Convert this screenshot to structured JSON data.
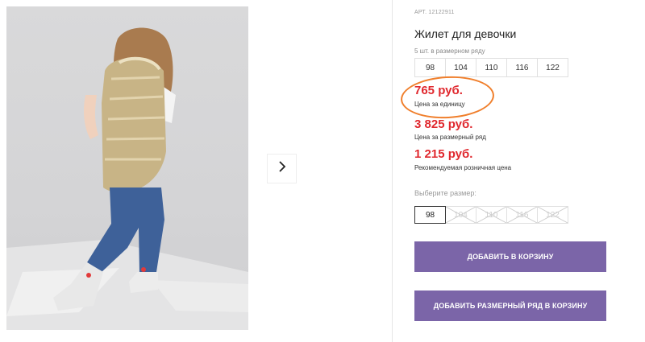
{
  "product": {
    "article": "АРТ. 12122911",
    "title": "Жилет для девочки",
    "pack_note": "5 шт. в размерном ряду",
    "sizes": [
      "98",
      "104",
      "110",
      "116",
      "122"
    ]
  },
  "prices": {
    "unit_price": "765 руб.",
    "unit_label": "Цена за единицу",
    "row_price": "3 825 руб.",
    "row_label": "Цена за размерный ряд",
    "retail_price": "1 215 руб.",
    "retail_label": "Рекомендуемая розничная цена"
  },
  "size_select": {
    "label": "Выберите размер:",
    "options": [
      "98",
      "104",
      "110",
      "116",
      "122"
    ],
    "selected": "98"
  },
  "buttons": {
    "add_to_cart": "Добавить в корзину",
    "add_row_to_cart": "Добавить размерный ряд в корзину"
  },
  "colors": {
    "price": "#e0282e",
    "button": "#7b65a8",
    "highlight": "#f07f2c"
  },
  "icons": {
    "next": "chevron-right-icon"
  }
}
